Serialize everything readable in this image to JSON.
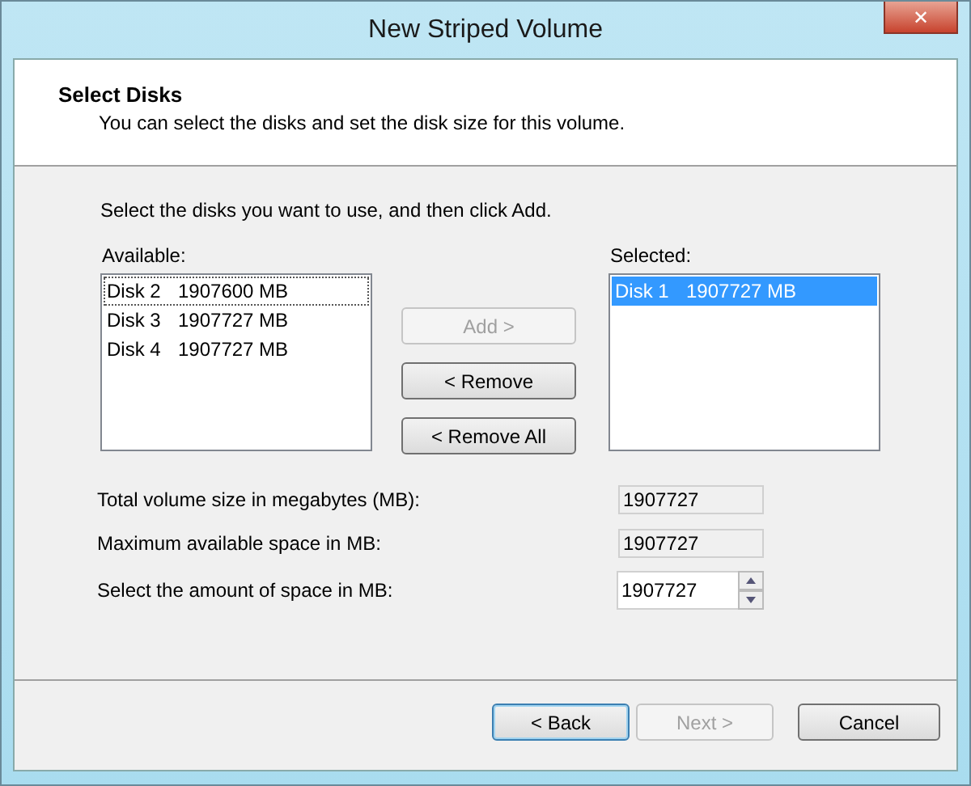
{
  "window": {
    "title": "New Striped Volume",
    "close_label": "✕"
  },
  "header": {
    "title": "Select Disks",
    "subtitle": "You can select the disks and set the disk size for this volume."
  },
  "instruction": "Select the disks you want to use, and then click Add.",
  "available": {
    "label": "Available:",
    "items": [
      {
        "name": "Disk 2",
        "size": "1907600 MB",
        "selected": false,
        "focused": true
      },
      {
        "name": "Disk 3",
        "size": "1907727 MB",
        "selected": false,
        "focused": false
      },
      {
        "name": "Disk 4",
        "size": "1907727 MB",
        "selected": false,
        "focused": false
      }
    ]
  },
  "move_buttons": [
    {
      "label": "Add >",
      "disabled": true
    },
    {
      "label": "< Remove",
      "disabled": false
    },
    {
      "label": "< Remove All",
      "disabled": false
    }
  ],
  "selected": {
    "label": "Selected:",
    "items": [
      {
        "name": "Disk 1",
        "size": "1907727 MB",
        "selected": true,
        "focused": false
      }
    ]
  },
  "fields": [
    {
      "label": "Total volume size in megabytes (MB):",
      "value": "1907727",
      "kind": "readonly"
    },
    {
      "label": "Maximum available space in MB:",
      "value": "1907727",
      "kind": "readonly"
    },
    {
      "label": "Select the amount of space in MB:",
      "value": "1907727",
      "kind": "spinner"
    }
  ],
  "footer_buttons": [
    {
      "label": "< Back",
      "disabled": false,
      "default": true
    },
    {
      "label": "Next >",
      "disabled": true,
      "default": false
    },
    {
      "label": "Cancel",
      "disabled": false,
      "default": false
    }
  ]
}
